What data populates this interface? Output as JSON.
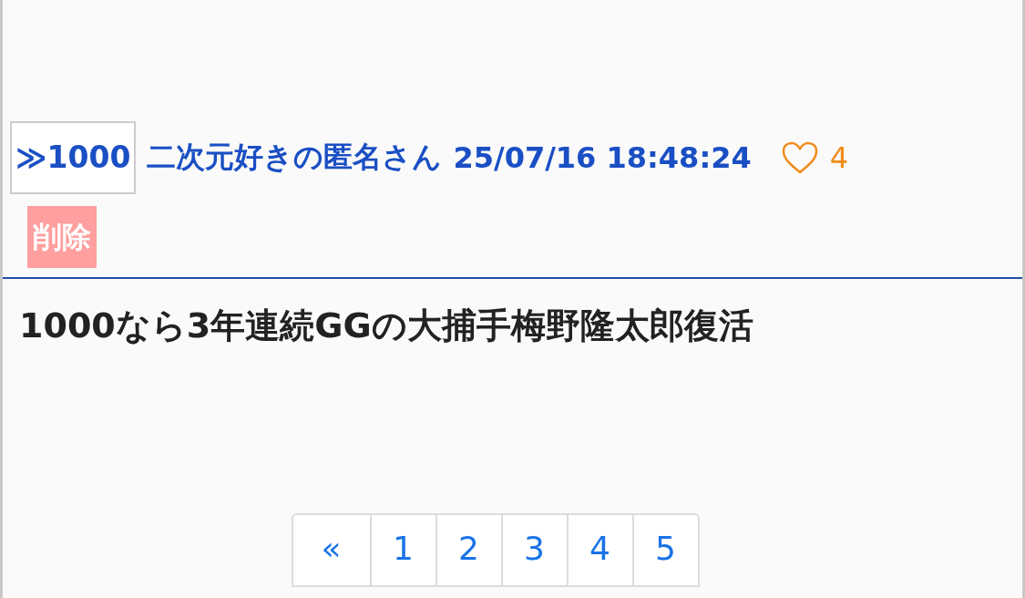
{
  "post": {
    "anchor": "≫1000",
    "author": "二次元好きの匿名さん",
    "timestamp": "25/07/16 18:48:24",
    "likes": "4",
    "delete_label": "削除",
    "body": "1000なら3年連続GGの大捕手梅野隆太郎復活"
  },
  "pagination": [
    {
      "label": "«"
    },
    {
      "label": "1"
    },
    {
      "label": "2"
    },
    {
      "label": "3"
    },
    {
      "label": "4"
    },
    {
      "label": "5"
    }
  ]
}
